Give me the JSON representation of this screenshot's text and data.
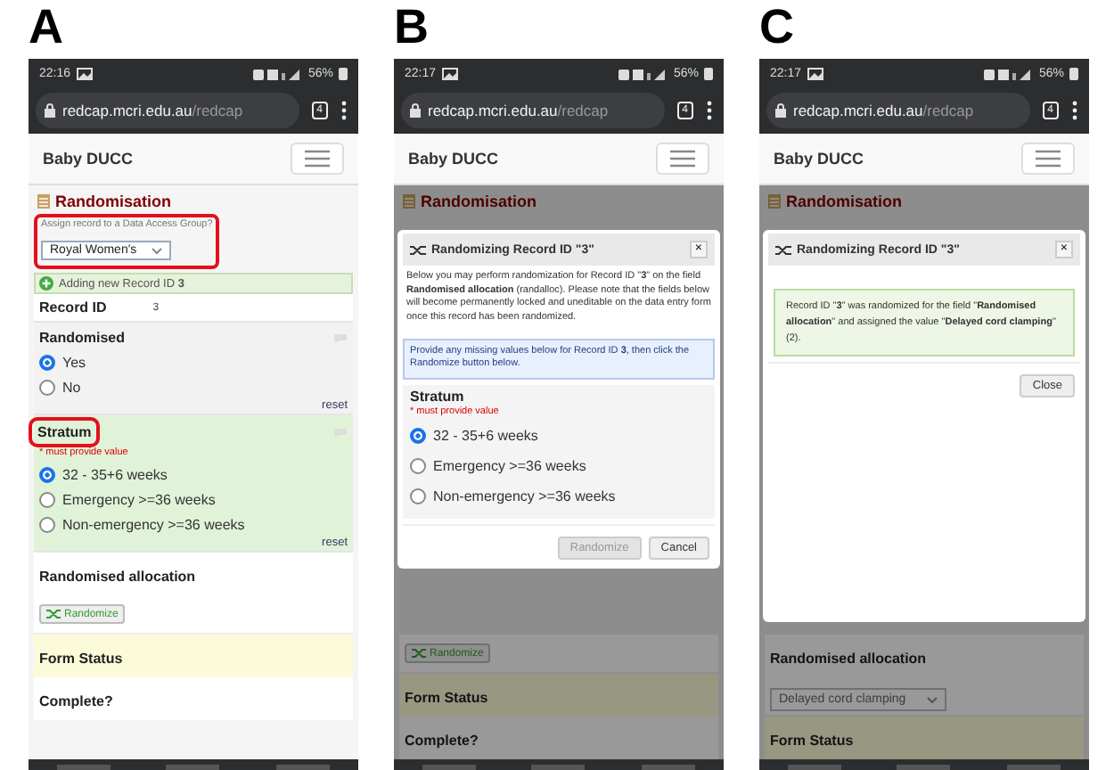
{
  "panels": [
    {
      "letter": "A",
      "time": "22:16",
      "battery": "56%",
      "url_host": "redcap.mcri.edu.au",
      "url_path": "/redcap",
      "tab_count": "4",
      "app_title": "Baby DUCC",
      "dimmed": false,
      "top": [
        {
          "kind": "section",
          "text": "Randomisation"
        },
        {
          "kind": "dag",
          "label": "Assign record to a Data Access Group?",
          "value": "Royal Women's",
          "highlighted": true
        },
        {
          "kind": "notice",
          "text": "Adding new Record ID **3**"
        },
        {
          "kind": "record_id",
          "label": "Record ID",
          "value": "3"
        },
        {
          "kind": "radio_field",
          "label": "Randomised",
          "highlighted": false,
          "tinted": false,
          "options": [
            {
              "label": "Yes",
              "selected": true
            },
            {
              "label": "No",
              "selected": false
            }
          ],
          "reset": "reset"
        },
        {
          "kind": "radio_field",
          "label": "Stratum",
          "highlighted": true,
          "tinted": true,
          "required": "* must provide value",
          "options": [
            {
              "label": "32 - 35+6 weeks",
              "selected": true
            },
            {
              "label": "Emergency >=36 weeks",
              "selected": false
            },
            {
              "label": "Non-emergency >=36 weeks",
              "selected": false
            }
          ],
          "reset": "reset"
        },
        {
          "kind": "label",
          "text": "Randomised allocation"
        },
        {
          "kind": "button",
          "text": "Randomize"
        },
        {
          "kind": "status",
          "text": "Form Status"
        },
        {
          "kind": "label",
          "text": "Complete?"
        }
      ]
    },
    {
      "letter": "B",
      "time": "22:17",
      "battery": "56%",
      "url_host": "redcap.mcri.edu.au",
      "url_path": "/redcap",
      "tab_count": "4",
      "app_title": "Baby DUCC",
      "dimmed": true,
      "top": [
        {
          "kind": "section",
          "text": "Randomisation"
        }
      ],
      "bottom": [
        {
          "kind": "button",
          "text": "Randomize"
        },
        {
          "kind": "status",
          "text": "Form Status"
        },
        {
          "kind": "label",
          "text": "Complete?"
        }
      ],
      "dialog": {
        "title": "Randomizing Record ID \"3\"",
        "close": "×",
        "blocks": [
          {
            "kind": "paragraph",
            "text": "Below you may perform randomization for Record ID \"**3**\" on the field **Randomised allocation** (randalloc). Please note that the fields below will become permanently locked and uneditable on the data entry form once this record has been randomized."
          },
          {
            "kind": "info",
            "text": "Provide any missing values below for Record ID **3**, then click the Randomize button below."
          },
          {
            "kind": "radio_field",
            "label": "Stratum",
            "required": "* must provide value",
            "options": [
              {
                "label": "32 - 35+6 weeks",
                "selected": true
              },
              {
                "label": "Emergency >=36 weeks",
                "selected": false
              },
              {
                "label": "Non-emergency >=36 weeks",
                "selected": false
              }
            ]
          },
          {
            "kind": "buttons",
            "buttons": [
              {
                "label": "Randomize",
                "disabled": true
              },
              {
                "label": "Cancel",
                "disabled": false
              }
            ]
          }
        ]
      }
    },
    {
      "letter": "C",
      "time": "22:17",
      "battery": "56%",
      "url_host": "redcap.mcri.edu.au",
      "url_path": "/redcap",
      "tab_count": "4",
      "app_title": "Baby DUCC",
      "dimmed": true,
      "top": [
        {
          "kind": "section",
          "text": "Randomisation"
        }
      ],
      "bottom": [
        {
          "kind": "label",
          "text": "Randomised allocation"
        },
        {
          "kind": "select",
          "value": "Delayed cord clamping"
        },
        {
          "kind": "status",
          "text": "Form Status"
        }
      ],
      "dialog": {
        "title": "Randomizing Record ID \"3\"",
        "close": "×",
        "blocks": [
          {
            "kind": "success",
            "text": "Record ID \"**3**\" was randomized for the field \"**Randomised allocation**\" and assigned the value \"**Delayed cord clamping**\" (2)."
          },
          {
            "kind": "buttons",
            "buttons": [
              {
                "label": "Close",
                "disabled": false
              }
            ]
          },
          {
            "kind": "blank"
          }
        ]
      }
    }
  ]
}
